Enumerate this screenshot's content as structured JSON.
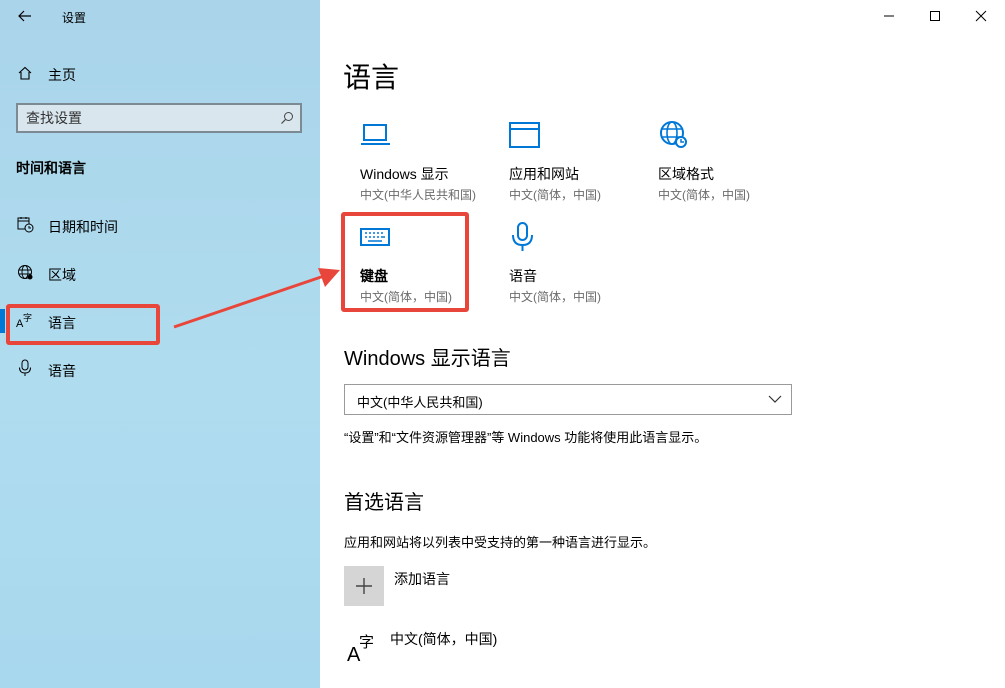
{
  "window": {
    "title": "设置",
    "controls": [
      "minimize",
      "maximize",
      "close"
    ]
  },
  "sidebar": {
    "home_label": "主页",
    "search_placeholder": "查找设置",
    "category_title": "时间和语言",
    "items": [
      {
        "label": "日期和时间",
        "icon": "calendar-clock-icon"
      },
      {
        "label": "区域",
        "icon": "globe-icon"
      },
      {
        "label": "语言",
        "icon": "language-icon",
        "selected": true
      },
      {
        "label": "语音",
        "icon": "microphone-icon"
      }
    ]
  },
  "main": {
    "page_title": "语言",
    "tiles": [
      {
        "title": "Windows 显示",
        "subtitle": "中文(中华人民共和国)",
        "icon": "monitor-icon"
      },
      {
        "title": "应用和网站",
        "subtitle": "中文(简体，中国)",
        "icon": "window-icon"
      },
      {
        "title": "区域格式",
        "subtitle": "中文(简体，中国)",
        "icon": "globe-icon"
      },
      {
        "title": "键盘",
        "subtitle": "中文(简体，中国)",
        "icon": "keyboard-icon"
      },
      {
        "title": "语音",
        "subtitle": "中文(简体，中国)",
        "icon": "microphone-icon"
      }
    ],
    "display_language": {
      "heading": "Windows 显示语言",
      "selected": "中文(中华人民共和国)",
      "description": "“设置”和“文件资源管理器”等 Windows 功能将使用此语言显示。"
    },
    "preferred_languages": {
      "heading": "首选语言",
      "description": "应用和网站将以列表中受支持的第一种语言进行显示。",
      "add_label": "添加语言",
      "languages": [
        {
          "label": "中文(简体，中国)"
        }
      ]
    }
  },
  "colors": {
    "accent": "#0078d7",
    "annotation": "#e8463a",
    "sidebar_bg": "#aed8ee"
  }
}
